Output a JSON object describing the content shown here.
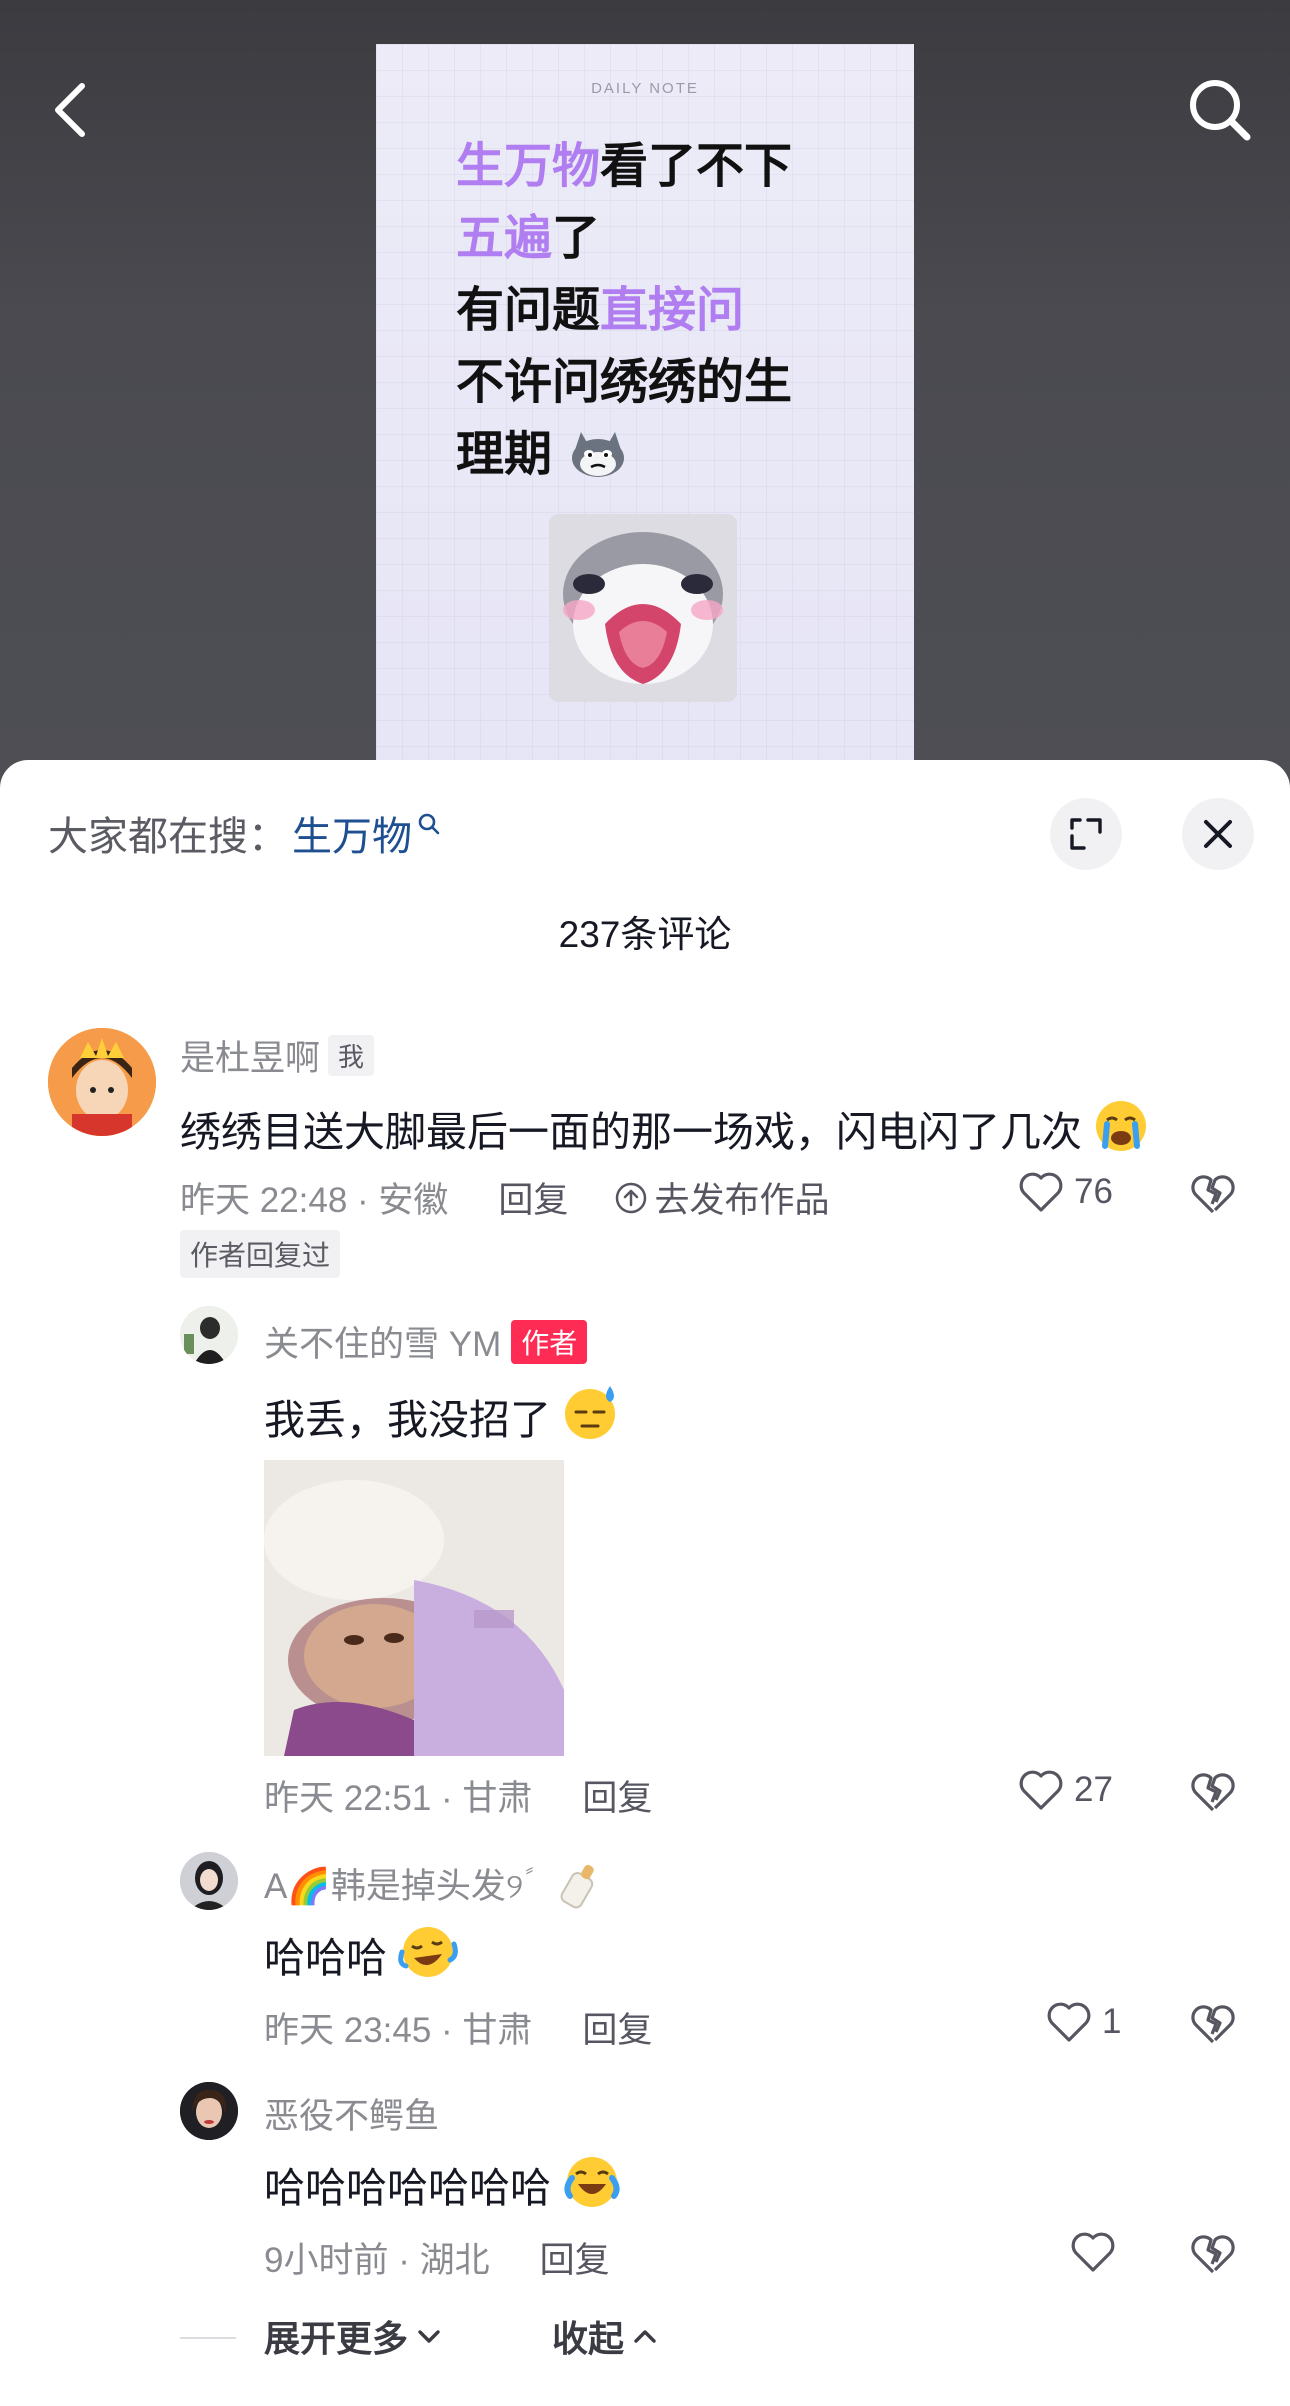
{
  "video": {
    "note_tag": "DAILY NOTE",
    "lines": [
      {
        "hl": "生万物",
        "rest": "看了不下"
      },
      {
        "hl": "五遍",
        "rest": "了"
      },
      {
        "pre": "有问题",
        "hl": "直接问"
      },
      {
        "plain": "不许问绣绣的生"
      },
      {
        "plain": "理期"
      }
    ],
    "dog_emoji_icon": "husky-face-icon",
    "highlight_color": "#b07ef0"
  },
  "sheet": {
    "search_prefix": "大家都在搜：",
    "search_term": "生万物",
    "comment_count_label": "237条评论"
  },
  "comments": [
    {
      "user": "是杜昱啊",
      "badge": "我",
      "text": "绣绣目送大脚最后一面的那一场戏，闪电闪了几次",
      "emoji": "crying-face-icon",
      "time_loc": "昨天 22:48 · 安徽",
      "reply": "回复",
      "publish": "去发布作品",
      "likes": "76",
      "author_replied": "作者回复过"
    },
    {
      "user": "关不住的雪 YM",
      "badge": "作者",
      "text": "我丢，我没招了",
      "emoji": "sweat-face-icon",
      "time_loc": "昨天 22:51 · 甘肃",
      "reply": "回复",
      "likes": "27"
    },
    {
      "user": "A🌈韩是掉头发୨ً",
      "text": "哈哈哈",
      "emoji": "laughing-tears-icon",
      "time_loc": "昨天 23:45 · 甘肃",
      "reply": "回复",
      "likes": "1"
    },
    {
      "user": "恶役不鳄鱼",
      "text": "哈哈哈哈哈哈哈",
      "emoji": "laughing-crying-icon",
      "time_loc": "9小时前 · 湖北",
      "reply": "回复",
      "likes": ""
    }
  ],
  "footer": {
    "expand_more": "展开更多",
    "collapse": "收起"
  }
}
